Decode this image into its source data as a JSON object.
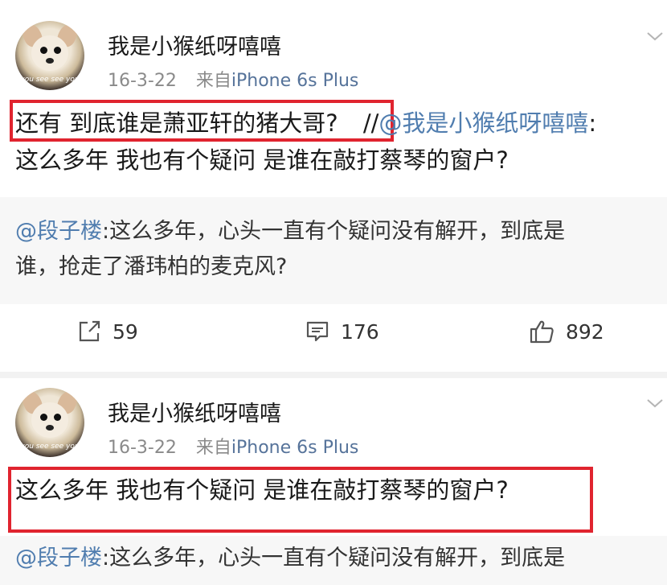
{
  "posts": [
    {
      "username": "我是小猴纸呀嘻嘻",
      "date": "16-3-22",
      "source_prefix": "来自",
      "source": "iPhone 6s Plus",
      "body": {
        "highlight": "还有 到底谁是萧亚轩的猪大哥?",
        "separator": " //",
        "mention": "@我是小猴纸呀嘻嘻",
        "rest_line1": ":",
        "line2": "这么多年 我也有个疑问 是谁在敲打蔡琴的窗户?"
      },
      "repost": {
        "mention": "@段子楼",
        "text_line1": ":这么多年，心头一直有个疑问没有解开，到底是",
        "text_line2": "谁，抢走了潘玮柏的麦克风?"
      },
      "actions": {
        "repost_count": "59",
        "comment_count": "176",
        "like_count": "892"
      }
    },
    {
      "username": "我是小猴纸呀嘻嘻",
      "date": "16-3-22",
      "source_prefix": "来自",
      "source": "iPhone 6s Plus",
      "body": {
        "text": "这么多年 我也有个疑问 是谁在敲打蔡琴的窗户?"
      },
      "repost": {
        "mention": "@段子楼",
        "text_line1": ":这么多年，心头一直有个疑问没有解开，到底是"
      }
    }
  ],
  "avatar_caption": "you see see you",
  "colors": {
    "highlight_border": "#e0242f",
    "mention": "#507daf",
    "source": "#56739a",
    "repost_bg": "#f7f7f7"
  }
}
